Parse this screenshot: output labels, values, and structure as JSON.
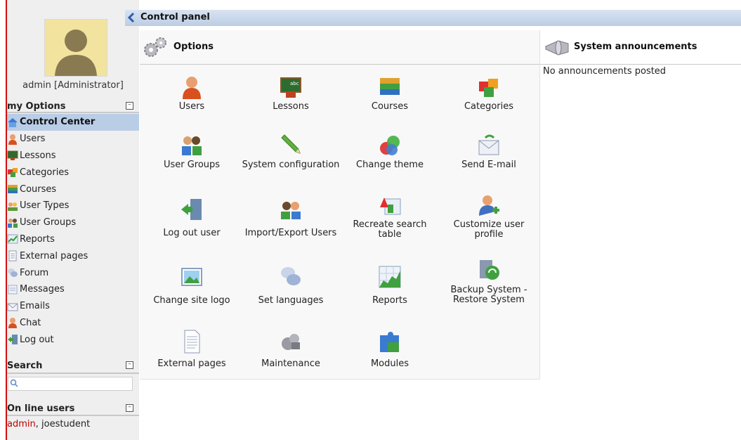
{
  "topbar": {
    "title": "Control panel"
  },
  "user": {
    "caption": "admin [Administrator]"
  },
  "sidebar": {
    "my_options_title": "my Options",
    "items": [
      {
        "label": "Control Center",
        "icon": "home-icon"
      },
      {
        "label": "Users",
        "icon": "user-icon"
      },
      {
        "label": "Lessons",
        "icon": "blackboard-icon"
      },
      {
        "label": "Categories",
        "icon": "categories-icon"
      },
      {
        "label": "Courses",
        "icon": "books-icon"
      },
      {
        "label": "User Types",
        "icon": "user-types-icon"
      },
      {
        "label": "User Groups",
        "icon": "user-groups-icon"
      },
      {
        "label": "Reports",
        "icon": "reports-icon"
      },
      {
        "label": "External pages",
        "icon": "page-icon"
      },
      {
        "label": "Forum",
        "icon": "forum-icon"
      },
      {
        "label": "Messages",
        "icon": "messages-icon"
      },
      {
        "label": "Emails",
        "icon": "email-icon"
      },
      {
        "label": "Chat",
        "icon": "chat-icon"
      },
      {
        "label": "Log out",
        "icon": "logout-icon"
      }
    ],
    "search_title": "Search",
    "search_placeholder": "",
    "online_title": "On line users",
    "online_me": "admin",
    "online_others": ", joestudent"
  },
  "options": {
    "title": "Options",
    "tiles": [
      {
        "label": "Users",
        "icon": "user-icon"
      },
      {
        "label": "Lessons",
        "icon": "blackboard-icon"
      },
      {
        "label": "Courses",
        "icon": "books-icon"
      },
      {
        "label": "Categories",
        "icon": "categories-icon"
      },
      {
        "label": "User Groups",
        "icon": "user-groups-icon"
      },
      {
        "label": "System configuration",
        "icon": "pencil-icon"
      },
      {
        "label": "Change theme",
        "icon": "theme-icon"
      },
      {
        "label": "Send E-mail",
        "icon": "send-email-icon"
      },
      {
        "label": "Log out user",
        "icon": "logout-door-icon"
      },
      {
        "label": "Import/Export Users",
        "icon": "import-export-icon"
      },
      {
        "label": "Recreate search table",
        "icon": "search-table-icon"
      },
      {
        "label": "Customize user profile",
        "icon": "user-add-icon"
      },
      {
        "label": "Change site logo",
        "icon": "image-icon"
      },
      {
        "label": "Set languages",
        "icon": "languages-icon"
      },
      {
        "label": "Reports",
        "icon": "reports-icon"
      },
      {
        "label": "Backup System - Restore System",
        "icon": "backup-icon"
      },
      {
        "label": "External pages",
        "icon": "document-icon"
      },
      {
        "label": "Maintenance",
        "icon": "maintenance-icon"
      },
      {
        "label": "Modules",
        "icon": "puzzle-icon"
      }
    ]
  },
  "announcements": {
    "title": "System announcements",
    "empty_text": "No announcements posted"
  }
}
